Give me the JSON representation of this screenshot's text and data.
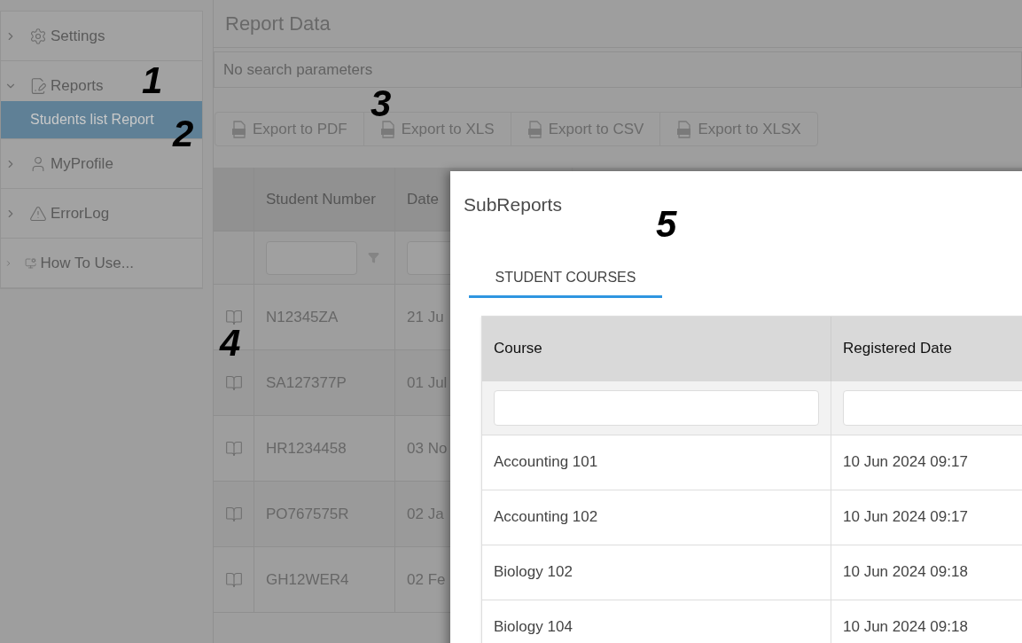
{
  "sidebar": {
    "items": [
      {
        "label": "Settings",
        "expanded": false
      },
      {
        "label": "Reports",
        "expanded": true,
        "children": [
          {
            "label": "Students list Report",
            "selected": true
          }
        ]
      },
      {
        "label": "MyProfile",
        "expanded": false
      },
      {
        "label": "ErrorLog",
        "expanded": false
      },
      {
        "label": "How To Use...",
        "expanded": false
      }
    ]
  },
  "page": {
    "title": "Report Data",
    "search_summary": "No search parameters",
    "export_buttons": [
      "Export to PDF",
      "Export to XLS",
      "Export to CSV",
      "Export to XLSX"
    ],
    "table": {
      "columns": [
        "Student Number",
        "Date"
      ],
      "rows": [
        [
          "N12345ZA",
          "21 Ju"
        ],
        [
          "SA127377P",
          "01 Jul"
        ],
        [
          "HR1234458",
          "03 No"
        ],
        [
          "PO767575R",
          "02 Ja"
        ],
        [
          "GH12WER4",
          "02 Fe"
        ]
      ]
    }
  },
  "dialog": {
    "title": "SubReports",
    "tabs": [
      {
        "label": "STUDENT COURSES",
        "selected": true
      }
    ],
    "table": {
      "columns": [
        "Course",
        "Registered Date"
      ],
      "rows": [
        [
          "Accounting 101",
          "10 Jun 2024 09:17"
        ],
        [
          "Accounting 102",
          "10 Jun 2024 09:17"
        ],
        [
          "Biology 102",
          "10 Jun 2024 09:18"
        ],
        [
          "Biology 104",
          "10 Jun 2024 09:18"
        ]
      ]
    }
  },
  "annotations": [
    "1",
    "2",
    "3",
    "4",
    "5"
  ]
}
